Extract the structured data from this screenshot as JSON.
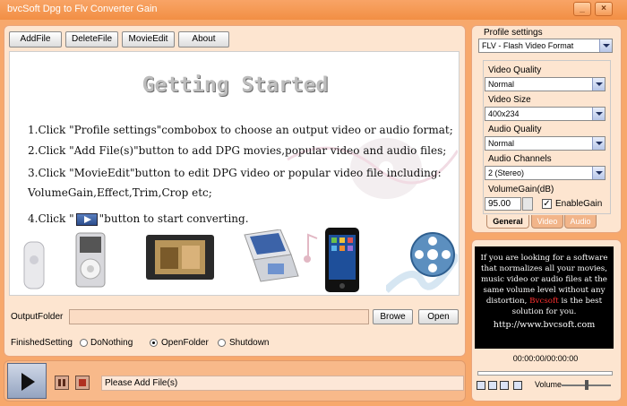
{
  "window": {
    "title": "bvcSoft Dpg to Flv Converter Gain"
  },
  "toolbar": {
    "add": "AddFile",
    "delete": "DeleteFile",
    "movie_edit": "MovieEdit",
    "about": "About"
  },
  "getting_started": {
    "title": "Getting Started",
    "step1": "1.Click \"Profile settings\"combobox to choose an output video or audio format;",
    "step2": "2.Click \"Add File(s)\"button to add DPG movies,popular video and audio files;",
    "step3a": "3.Click \"MovieEdit\"button to edit DPG video or popular video file including:",
    "step3b": "VolumeGain,Effect,Trim,Crop etc;",
    "step4_pre": "4.Click \"",
    "step4_post": "\"button to start converting."
  },
  "output": {
    "label": "OutputFolder",
    "value": "",
    "browse": "Browe",
    "open": "Open"
  },
  "finished": {
    "label": "FinishedSetting",
    "options": [
      "DoNothing",
      "OpenFolder",
      "Shutdown"
    ],
    "selected": "OpenFolder"
  },
  "status": {
    "text": "Please Add File(s)"
  },
  "profile": {
    "label": "Profile settings",
    "format": "FLV - Flash Video Format",
    "video_quality_label": "Video Quality",
    "video_quality": "Normal",
    "video_size_label": "Video Size",
    "video_size": "400x234",
    "audio_quality_label": "Audio Quality",
    "audio_quality": "Normal",
    "audio_channels_label": "Audio Channels",
    "audio_channels": "2 (Stereo)",
    "volume_gain_label": "VolumeGain(dB)",
    "volume_gain": "95.00",
    "enable_gain_label": "EnableGain",
    "enable_gain": true,
    "tabs": [
      "General",
      "Video",
      "Audio"
    ],
    "active_tab": "General"
  },
  "preview": {
    "line1": "If you are looking for a software",
    "line2": "that normalizes all your movies,",
    "line3": "music video or audio files at the",
    "line4": "same volume level without any",
    "line5_pre": "distortion, ",
    "brand": "Bvcsoft",
    "line5_post": " is the best",
    "line6": "solution for you.",
    "url": "http://www.bvcsoft.com",
    "time": "00:00:00/00:00:00",
    "volume_label": "Volume"
  },
  "icons": [
    "minimize-icon",
    "close-icon",
    "play-icon",
    "pause-icon",
    "stop-icon",
    "dropdown-arrow-icon"
  ],
  "colors": {
    "frame": "#f7a86c",
    "panel": "#fde5d0",
    "brand_red": "#ff3030"
  }
}
